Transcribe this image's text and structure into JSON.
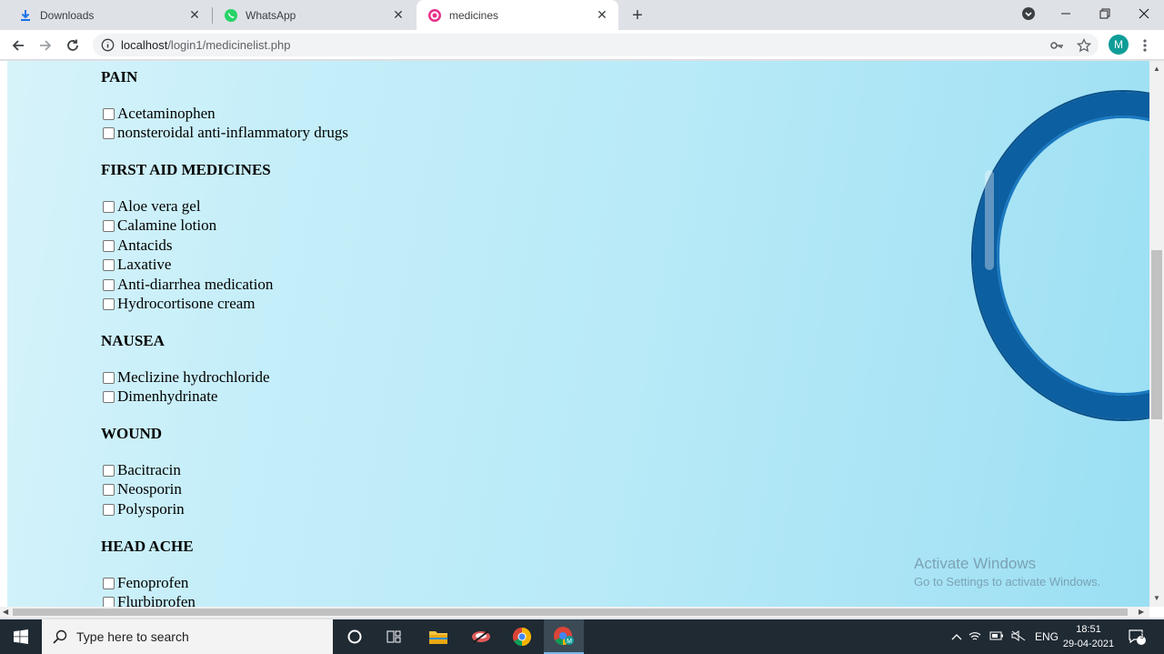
{
  "browser": {
    "tabs": [
      {
        "title": "Downloads",
        "icon": "download-icon"
      },
      {
        "title": "WhatsApp",
        "icon": "whatsapp-icon"
      },
      {
        "title": "medicines",
        "icon": "site-favicon",
        "active": true
      }
    ],
    "url_host": "localhost",
    "url_path": "/login1/medicinelist.php",
    "profile_initial": "M"
  },
  "page": {
    "categories": [
      {
        "name": "PAIN",
        "items": [
          "Acetaminophen",
          "nonsteroidal anti-inflammatory drugs"
        ]
      },
      {
        "name": "FIRST AID MEDICINES",
        "items": [
          "Aloe vera gel",
          "Calamine lotion",
          "Antacids",
          "Laxative",
          "Anti-diarrhea medication",
          "Hydrocortisone cream"
        ]
      },
      {
        "name": "NAUSEA",
        "items": [
          "Meclizine hydrochloride",
          "Dimenhydrinate"
        ]
      },
      {
        "name": "WOUND",
        "items": [
          "Bacitracin",
          "Neosporin",
          "Polysporin"
        ]
      },
      {
        "name": "HEAD ACHE",
        "items": [
          "Fenoprofen",
          "Flurbiprofen"
        ]
      }
    ],
    "watermark": {
      "line1": "Activate Windows",
      "line2": "Go to Settings to activate Windows."
    }
  },
  "taskbar": {
    "search_placeholder": "Type here to search",
    "tray_lang": "ENG",
    "time": "18:51",
    "date": "29-04-2021",
    "notification_count": "9"
  },
  "colors": {
    "page_accent": "#b8eaf7",
    "ring": "#0c5fa0",
    "taskbar": "#1f2a33"
  }
}
